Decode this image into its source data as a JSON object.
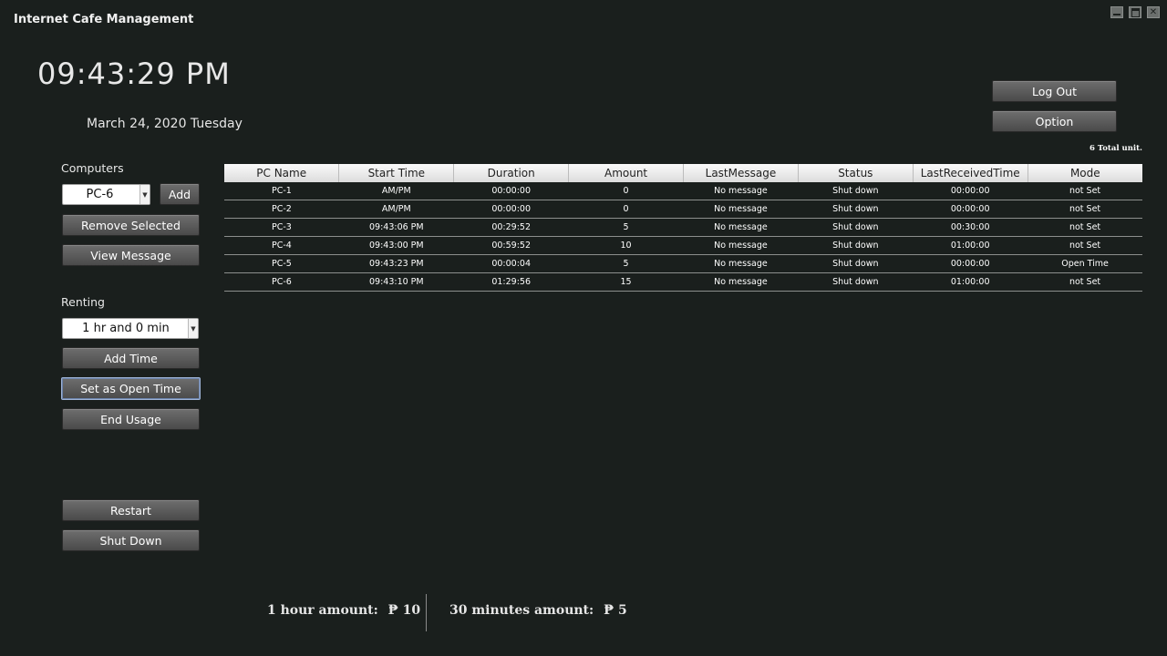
{
  "app": {
    "title": "Internet Cafe Management"
  },
  "clock": {
    "time": "09:43:29 PM",
    "date": "March 24, 2020 Tuesday"
  },
  "header_buttons": {
    "logout": "Log Out",
    "option": "Option"
  },
  "total_units": "6 Total unit.",
  "computers": {
    "label": "Computers",
    "selected": "PC-6",
    "add": "Add",
    "remove_selected": "Remove Selected",
    "view_message": "View Message"
  },
  "renting": {
    "label": "Renting",
    "selected_duration": "1 hr and 0 min",
    "add_time": "Add Time",
    "set_open_time": "Set as Open Time",
    "end_usage": "End Usage"
  },
  "power": {
    "restart": "Restart",
    "shutdown": "Shut Down"
  },
  "table": {
    "columns": [
      "PC Name",
      "Start Time",
      "Duration",
      "Amount",
      "LastMessage",
      "Status",
      "LastReceivedTime",
      "Mode"
    ],
    "rows": [
      [
        "PC-1",
        "AM/PM",
        "00:00:00",
        "0",
        "No message",
        "Shut down",
        "00:00:00",
        "not Set"
      ],
      [
        "PC-2",
        "AM/PM",
        "00:00:00",
        "0",
        "No message",
        "Shut down",
        "00:00:00",
        "not Set"
      ],
      [
        "PC-3",
        "09:43:06 PM",
        "00:29:52",
        "5",
        "No message",
        "Shut down",
        "00:30:00",
        "not Set"
      ],
      [
        "PC-4",
        "09:43:00 PM",
        "00:59:52",
        "10",
        "No message",
        "Shut down",
        "01:00:00",
        "not Set"
      ],
      [
        "PC-5",
        "09:43:23 PM",
        "00:00:04",
        "5",
        "No message",
        "Shut down",
        "00:00:00",
        "Open Time"
      ],
      [
        "PC-6",
        "09:43:10 PM",
        "01:29:56",
        "15",
        "No message",
        "Shut down",
        "01:00:00",
        "not Set"
      ]
    ]
  },
  "footer": {
    "hour_label": "1 hour amount:",
    "hour_value": "₱ 10",
    "half_label": "30 minutes amount:",
    "half_value": "₱ 5"
  },
  "icons": {
    "minimize": "minimize-icon",
    "maximize": "maximize-icon",
    "close": "close-icon",
    "dropdown": "chevron-down-icon"
  },
  "colors": {
    "background": "#1a1f1d",
    "button": "#5a5a5a",
    "header": "#e6e6e6"
  }
}
